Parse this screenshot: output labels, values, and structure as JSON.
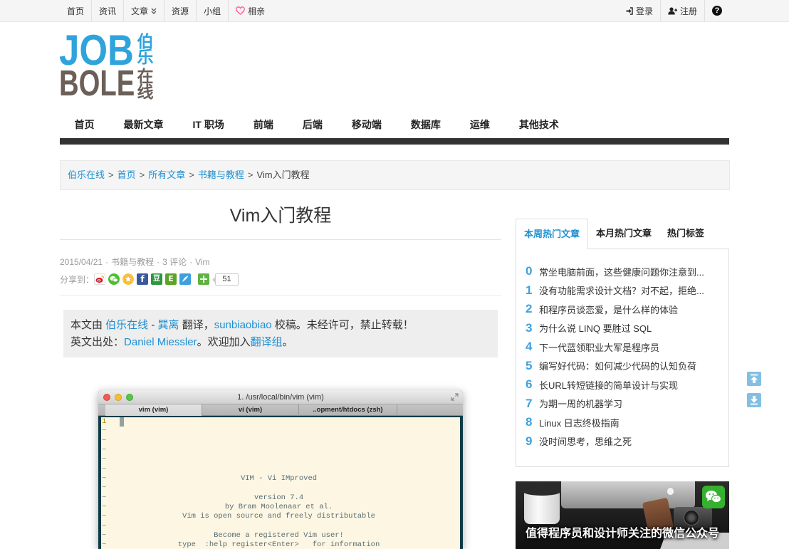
{
  "topbar": {
    "nav": [
      "首页",
      "资讯",
      "文章",
      "资源",
      "小组",
      "相亲"
    ],
    "article_caret_icon": "double-chevron-down-icon",
    "heart_icon": "heart-icon",
    "login": "登录",
    "login_icon": "sign-in-icon",
    "register": "注册",
    "register_icon": "user-plus-icon",
    "help_icon": "question-circle-icon",
    "help_glyph": "?"
  },
  "logo": {
    "latin_top": "JOB",
    "latin_bottom": "BOLE",
    "cn_top": [
      "伯",
      "乐"
    ],
    "cn_bottom": [
      "在",
      "线"
    ]
  },
  "main_nav": [
    "首页",
    "最新文章",
    "IT 职场",
    "前端",
    "后端",
    "移动端",
    "数据库",
    "运维",
    "其他技术"
  ],
  "breadcrumb": {
    "separator": ">",
    "items": [
      "伯乐在线",
      "首页",
      "所有文章",
      "书籍与教程",
      "Vim入门教程"
    ]
  },
  "article": {
    "title": "Vim入门教程",
    "meta": {
      "date": "2015/04/21",
      "dot": "·",
      "category": "书籍与教程",
      "comments": "3 评论",
      "tag": "Vim"
    },
    "share": {
      "label": "分享到：",
      "icons": [
        {
          "name": "weibo-icon"
        },
        {
          "name": "wechat-icon"
        },
        {
          "name": "qzone-icon"
        },
        {
          "name": "facebook-icon",
          "glyph": "f"
        },
        {
          "name": "douban-icon",
          "glyph": "豆"
        },
        {
          "name": "evernote-icon",
          "glyph": "E"
        },
        {
          "name": "note-icon"
        }
      ],
      "more_icon": "plus-icon",
      "count": "51"
    },
    "credit": {
      "line1": [
        {
          "text": "本文由 "
        },
        {
          "text": "伯乐在线",
          "link": true
        },
        {
          "text": " - "
        },
        {
          "text": "巽离",
          "link": true
        },
        {
          "text": " 翻译，"
        },
        {
          "text": "sunbiaobiao",
          "link": true
        },
        {
          "text": " 校稿。未经许可，禁止转载！"
        }
      ],
      "line2": [
        {
          "text": "英文出处："
        },
        {
          "text": "Daniel Miessler",
          "link": true
        },
        {
          "text": "。欢迎加入"
        },
        {
          "text": "翻译组",
          "link": true
        },
        {
          "text": "。"
        }
      ]
    },
    "image": {
      "title": "1. /usr/local/bin/vim (vim)",
      "tabs": [
        "vim (vim)",
        "vi (vim)",
        "..opment/htdocs (zsh)"
      ],
      "line_number": "1",
      "tilde": "~",
      "intro": [
        "VIM - Vi IMproved",
        "version 7.4",
        "by Bram Moolenaar et al.",
        "Vim is open source and freely distributable",
        "Become a registered Vim user!",
        "type  :help register<Enter>   for information"
      ]
    }
  },
  "sidebar": {
    "tabs": [
      "本周热门文章",
      "本月热门文章",
      "热门标签"
    ],
    "active_tab": 0,
    "hot_list": [
      {
        "rank": "0",
        "title": "常坐电脑前面，这些健康问题你注意到..."
      },
      {
        "rank": "1",
        "title": "没有功能需求设计文档？对不起，拒绝..."
      },
      {
        "rank": "2",
        "title": "和程序员谈恋爱，是什么样的体验"
      },
      {
        "rank": "3",
        "title": "为什么说 LINQ 要胜过 SQL"
      },
      {
        "rank": "4",
        "title": "下一代蓝领职业大军是程序员"
      },
      {
        "rank": "5",
        "title": "编写好代码：如何减少代码的认知负荷"
      },
      {
        "rank": "6",
        "title": "长URL转短链接的简单设计与实现"
      },
      {
        "rank": "7",
        "title": "为期一周的机器学习"
      },
      {
        "rank": "8",
        "title": "Linux 日志终极指南"
      },
      {
        "rank": "9",
        "title": "没时间思考，思维之死"
      }
    ]
  },
  "ad": {
    "caption": "值得程序员和设计师关注的微信公众号",
    "icon": "wechat-icon"
  },
  "float_buttons": {
    "up_icon": "scroll-to-top-icon",
    "down_icon": "scroll-to-bottom-icon"
  },
  "colors": {
    "link": "#1d8fd2",
    "hot_rank": "#3fa1dd",
    "heart": "#ff5c8a",
    "nav_strip": "#333333",
    "logo_blue": "#2ea3dc",
    "logo_brown": "#6b5f58",
    "vim_background": "#fdf6e3",
    "float_button": "#84bfe2"
  }
}
